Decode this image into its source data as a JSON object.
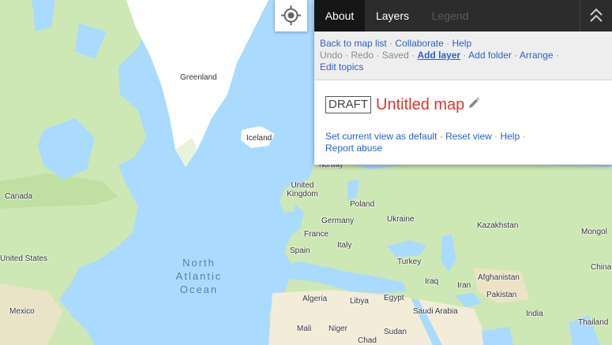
{
  "map": {
    "ocean_label": "North Atlantic Ocean",
    "places": [
      {
        "id": "greenland",
        "name": "Greenland"
      },
      {
        "id": "iceland",
        "name": "Iceland"
      },
      {
        "id": "norway",
        "name": "Norway"
      },
      {
        "id": "canada",
        "name": "Canada"
      },
      {
        "id": "uk",
        "name": "United Kingdom"
      },
      {
        "id": "poland",
        "name": "Poland"
      },
      {
        "id": "germany",
        "name": "Germany"
      },
      {
        "id": "ukraine",
        "name": "Ukraine"
      },
      {
        "id": "kazakhstan",
        "name": "Kazakhstan"
      },
      {
        "id": "mongolia",
        "name": "Mongol"
      },
      {
        "id": "france",
        "name": "France"
      },
      {
        "id": "italy",
        "name": "Italy"
      },
      {
        "id": "spain",
        "name": "Spain"
      },
      {
        "id": "usa",
        "name": "United States"
      },
      {
        "id": "turkey",
        "name": "Turkey"
      },
      {
        "id": "china",
        "name": "China"
      },
      {
        "id": "afghanistan",
        "name": "Afghanistan"
      },
      {
        "id": "iraq",
        "name": "Iraq"
      },
      {
        "id": "iran",
        "name": "Iran"
      },
      {
        "id": "pakistan",
        "name": "Pakistan"
      },
      {
        "id": "algeria",
        "name": "Algeria"
      },
      {
        "id": "libya",
        "name": "Libya"
      },
      {
        "id": "egypt",
        "name": "Egypt"
      },
      {
        "id": "saudi",
        "name": "Saudi Arabia"
      },
      {
        "id": "mexico",
        "name": "Mexico"
      },
      {
        "id": "india",
        "name": "India"
      },
      {
        "id": "thailand",
        "name": "Thailand"
      },
      {
        "id": "mali",
        "name": "Mali"
      },
      {
        "id": "niger",
        "name": "Niger"
      },
      {
        "id": "sudan",
        "name": "Sudan"
      },
      {
        "id": "chad",
        "name": "Chad"
      }
    ]
  },
  "panel": {
    "tabs": [
      {
        "label": "About",
        "state": "active"
      },
      {
        "label": "Layers",
        "state": "normal"
      },
      {
        "label": "Legend",
        "state": "disabled"
      }
    ],
    "toolbar": {
      "back": "Back to map list",
      "collaborate": "Collaborate",
      "help": "Help",
      "undo": "Undo",
      "redo": "Redo",
      "saved": "Saved",
      "add_layer": "Add layer",
      "add_folder": "Add folder",
      "arrange": "Arrange",
      "edit_topics": "Edit topics",
      "separator": "·"
    },
    "draft_badge": "DRAFT",
    "map_title": "Untitled map",
    "links": {
      "set_default": "Set current view as default",
      "reset_view": "Reset view",
      "help": "Help",
      "report_abuse": "Report abuse"
    }
  },
  "colors": {
    "water": "#aadaff",
    "land": "#cde8b4",
    "ice": "#ffffff",
    "desert": "#f2ecd8",
    "title_red": "#d9362b",
    "link_blue": "#2962c9"
  }
}
